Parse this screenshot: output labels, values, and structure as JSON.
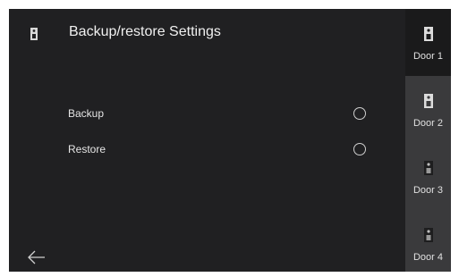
{
  "header": {
    "title": "Backup/restore Settings",
    "icon": "door-station-icon"
  },
  "options": [
    {
      "label": "Backup",
      "selected": false
    },
    {
      "label": "Restore",
      "selected": false
    }
  ],
  "footer": {
    "back_icon": "back-arrow-icon"
  },
  "sidebar": {
    "doors": [
      {
        "label": "Door 1",
        "active": true
      },
      {
        "label": "Door 2",
        "active": false
      },
      {
        "label": "Door 3",
        "active": false
      },
      {
        "label": "Door 4",
        "active": false
      }
    ]
  },
  "colors": {
    "background": "#202022",
    "sidebar": "#3a3a3c",
    "sidebar_active": "#1a1a1b",
    "text": "#eaeaea"
  }
}
